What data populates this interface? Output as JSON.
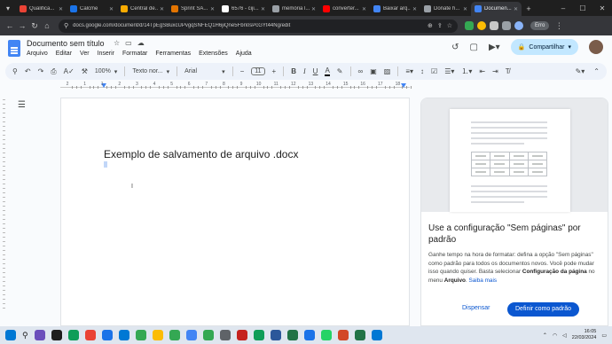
{
  "browser": {
    "tabs": [
      {
        "title": "Qualifica...",
        "color": "#ea4335",
        "active": false
      },
      {
        "title": "Calcme",
        "color": "#1a73e8",
        "active": false
      },
      {
        "title": "Central de...",
        "color": "#f9ab00",
        "active": false
      },
      {
        "title": "Sprint SA...",
        "color": "#e37400",
        "active": false
      },
      {
        "title": "6576 - ciji...",
        "color": "#ffffff",
        "active": false
      },
      {
        "title": "memória l...",
        "color": "#9aa0a6",
        "active": false
      },
      {
        "title": "converter...",
        "color": "#ff0000",
        "active": false
      },
      {
        "title": "Baixar arq...",
        "color": "#4285f4",
        "active": false
      },
      {
        "title": "Donate h...",
        "color": "#9aa0a6",
        "active": false
      },
      {
        "title": "Documen...",
        "color": "#4285f4",
        "active": true
      }
    ],
    "url": "docs.google.com/document/d/14TpEgSBuxcUPvgqSNFEQ1H6jiQne5Fbn0sPcGYt44Ng/edit",
    "profile_label": "Erro"
  },
  "docs": {
    "title": "Documento sem título",
    "menu": [
      "Arquivo",
      "Editar",
      "Ver",
      "Inserir",
      "Formatar",
      "Ferramentas",
      "Extensões",
      "Ajuda"
    ],
    "share_label": "Compartilhar",
    "toolbar": {
      "zoom": "100%",
      "style": "Texto nor...",
      "font": "Arial",
      "font_size": "11"
    },
    "ruler_numbers": [
      "2",
      "1",
      "1",
      "2",
      "3",
      "4",
      "5",
      "6",
      "7",
      "8",
      "9",
      "10",
      "11",
      "12",
      "13",
      "14",
      "15",
      "16",
      "17",
      "18"
    ],
    "document_text": "Exemplo de salvamento de arquivo .docx"
  },
  "panel": {
    "title": "Use a configuração \"Sem páginas\" por padrão",
    "body_start": "Ganhe tempo na hora de formatar: defina a opção \"Sem páginas\" como padrão para todos os documentos novos. Você pode mudar isso quando quiser. Basta selecionar ",
    "body_bold": "Configuração da página",
    "body_mid": " no menu ",
    "body_bold2": "Arquivo",
    "body_end": ". ",
    "link": "Saiba mais",
    "dismiss": "Dispensar",
    "set_default": "Definir como padrão"
  },
  "taskbar": {
    "time": "16:05",
    "date": "22/03/2024"
  }
}
